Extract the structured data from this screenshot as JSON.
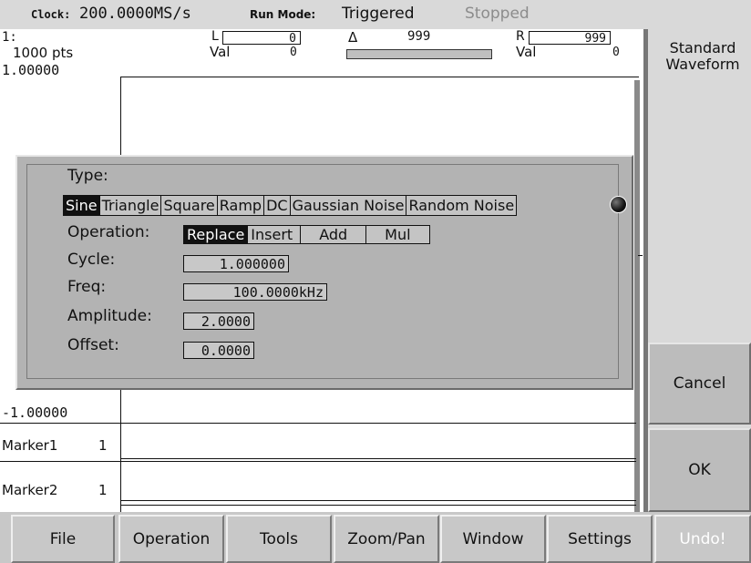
{
  "status": {
    "clock_label": "Clock:",
    "clock_value": "200.0000MS/s",
    "run_mode_label": "Run Mode:",
    "run_mode_value": "Triggered",
    "state": "Stopped"
  },
  "plot": {
    "channel": "1:",
    "points": "1000 pts",
    "y_top": "1.00000",
    "y_bottom": "-1.00000",
    "left_cursor_label": "L",
    "left_cursor_value": "0",
    "left_val_label": "Val",
    "left_val_value": "0",
    "delta_label": "Δ",
    "delta_value": "999",
    "right_cursor_label": "R",
    "right_cursor_value": "999",
    "right_val_label": "Val",
    "right_val_value": "0",
    "marker1_label": "Marker1",
    "marker1_value": "1",
    "marker2_label": "Marker2",
    "marker2_value": "1"
  },
  "side_title": "Standard Waveform",
  "dialog": {
    "type_label": "Type:",
    "types": [
      "Sine",
      "Triangle",
      "Square",
      "Ramp",
      "DC",
      "Gaussian Noise",
      "Random Noise"
    ],
    "selected_type": "Sine",
    "operation_label": "Operation:",
    "operations": [
      "Replace",
      "Insert",
      "Add",
      "Mul"
    ],
    "selected_operation": "Replace",
    "cycle_label": "Cycle:",
    "cycle_value": "1.000000",
    "freq_label": "Freq:",
    "freq_value": "100.0000kHz",
    "amplitude_label": "Amplitude:",
    "amplitude_value": "2.0000",
    "offset_label": "Offset:",
    "offset_value": "0.0000"
  },
  "buttons": {
    "cancel": "Cancel",
    "ok": "OK"
  },
  "menu": [
    "File",
    "Operation",
    "Tools",
    "Zoom/Pan",
    "Window",
    "Settings",
    "Undo!"
  ],
  "colors": {
    "panel": "#b3b3b3",
    "side": "#d9d9d9",
    "selected": "#111111",
    "disabled_text": "#ffffff"
  }
}
